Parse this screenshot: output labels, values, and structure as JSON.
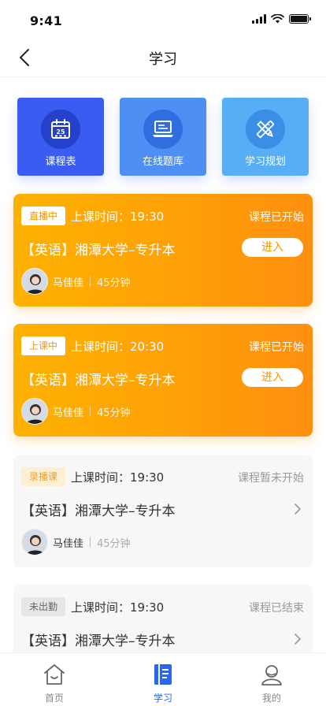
{
  "status_bar": {
    "time": "9:41"
  },
  "nav": {
    "title": "学习"
  },
  "quick_actions": [
    {
      "label": "课程表",
      "icon": "calendar-icon"
    },
    {
      "label": "在线题库",
      "icon": "laptop-icon"
    },
    {
      "label": "学习规划",
      "icon": "pencil-ruler-icon"
    }
  ],
  "courses": [
    {
      "badge": "直播中",
      "time": "上课时间：19:30",
      "status": "课程已开始",
      "name": "【英语】湘潭大学–专升本",
      "action": "进入",
      "teacher": "马佳佳",
      "duration": "45分钟"
    },
    {
      "badge": "上课中",
      "time": "上课时间：20:30",
      "status": "课程已开始",
      "name": "【英语】湘潭大学–专升本",
      "action": "进入",
      "teacher": "马佳佳",
      "duration": "45分钟"
    },
    {
      "badge": "录播课",
      "time": "上课时间：19:30",
      "status": "课程暂未开始",
      "name": "【英语】湘潭大学–专升本",
      "teacher": "马佳佳",
      "duration": "45分钟"
    },
    {
      "badge": "未出勤",
      "time": "上课时间：19:30",
      "status": "课程已结束",
      "name": "【英语】湘潭大学–专升本"
    }
  ],
  "tabs": [
    {
      "label": "首页",
      "icon": "home-icon"
    },
    {
      "label": "学习",
      "icon": "book-icon"
    },
    {
      "label": "我的",
      "icon": "user-icon"
    }
  ],
  "colors": {
    "accent": "#2b66f0",
    "orange": "#ff9500"
  }
}
